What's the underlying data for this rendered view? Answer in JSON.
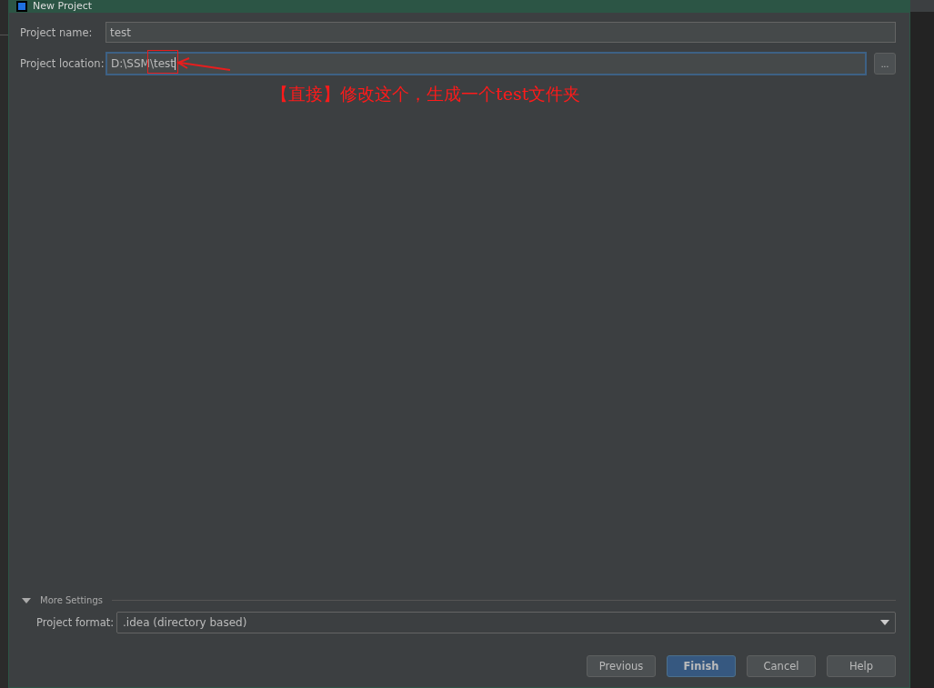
{
  "window": {
    "title": "New Project"
  },
  "fields": [
    {
      "label": "Project name:",
      "value": "test",
      "focused": false,
      "kind": "text"
    },
    {
      "label": "Project location:",
      "value": "D:\\SSM\\test",
      "focused": true,
      "kind": "path",
      "browse": "..."
    }
  ],
  "annotation": {
    "text": "【直接】修改这个，生成一个test文件夹"
  },
  "more_settings": {
    "label": "More Settings",
    "expanded": true,
    "format_label": "Project format:",
    "format_value": ".idea (directory based)"
  },
  "buttons": [
    {
      "label": "Previous",
      "primary": false
    },
    {
      "label": "Finish",
      "primary": true
    },
    {
      "label": "Cancel",
      "primary": false
    },
    {
      "label": "Help",
      "primary": false
    }
  ]
}
